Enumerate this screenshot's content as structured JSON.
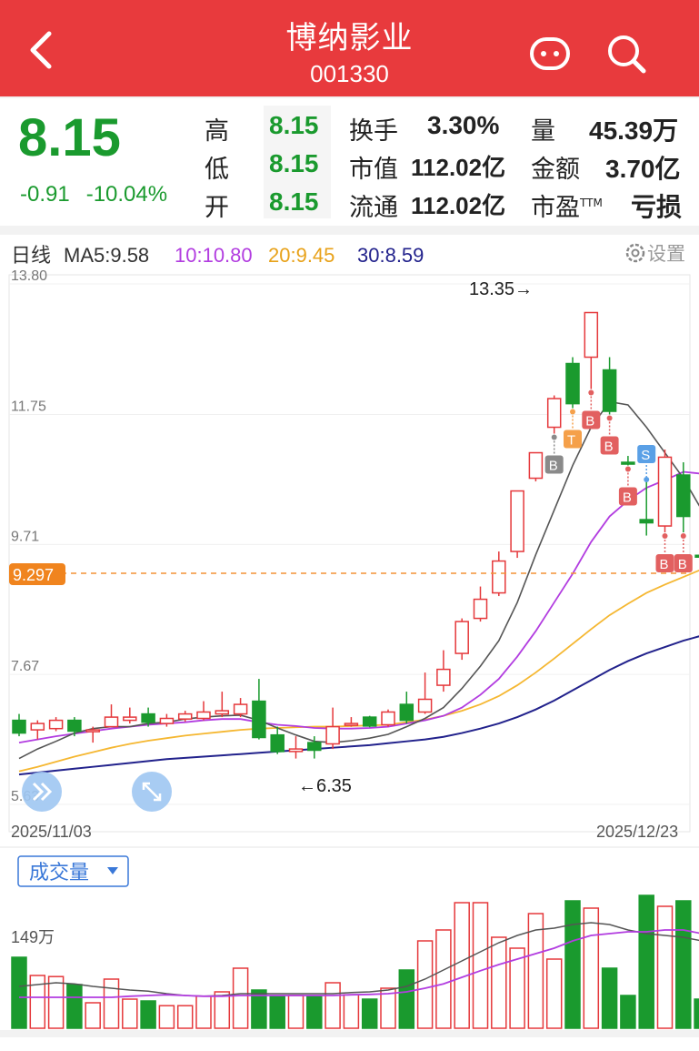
{
  "header": {
    "title": "博纳影业",
    "code": "001330",
    "back_icon": "back-arrow-icon",
    "robot_icon": "robot-face-icon",
    "search_icon": "search-icon"
  },
  "quote": {
    "price": "8.15",
    "change": "-0.91",
    "change_pct": "-10.04%",
    "high_label": "高",
    "high": "8.15",
    "low_label": "低",
    "low": "8.15",
    "open_label": "开",
    "open": "8.15",
    "turnover_label": "换手",
    "turnover": "3.30%",
    "mktcap_label": "市值",
    "mktcap": "112.02亿",
    "float_label": "流通",
    "float_cap": "112.02亿",
    "volume_label": "量",
    "volume": "45.39万",
    "amount_label": "金额",
    "amount": "3.70亿",
    "pe_label": "市盈",
    "pe_sup": "TTM",
    "pe": "亏损",
    "down_color": "#1a9a2e",
    "up_color": "#e5383b"
  },
  "kline": {
    "period": "日线",
    "ma5_label": "MA5:9.58",
    "ma10_label": "10:10.80",
    "ma20_label": "20:9.45",
    "ma30_label": "30:8.59",
    "settings_label": "设置",
    "y_ticks": [
      "13.80",
      "11.75",
      "9.71",
      "7.67",
      "5.63"
    ],
    "price_tag": "9.297",
    "max_label": "13.35→",
    "min_label": "←6.35",
    "start_date": "2025/11/03",
    "end_date": "2025/12/23",
    "ma_colors": {
      "ma5": "#555555",
      "ma10": "#b23de0",
      "ma20": "#f5b731",
      "ma30": "#22228c"
    }
  },
  "volume": {
    "tab_label": "成交量",
    "tick": "149万"
  },
  "chart_data": {
    "type": "candlestick",
    "x_start": "2025/11/03",
    "x_end": "2025/12/23",
    "ylim": [
      5.63,
      13.8
    ],
    "candles": [
      {
        "o": 6.95,
        "c": 6.75,
        "h": 7.05,
        "l": 6.7
      },
      {
        "o": 6.8,
        "c": 6.9,
        "h": 6.95,
        "l": 6.65
      },
      {
        "o": 6.82,
        "c": 6.95,
        "h": 7.0,
        "l": 6.78
      },
      {
        "o": 6.95,
        "c": 6.78,
        "h": 7.0,
        "l": 6.7
      },
      {
        "o": 6.78,
        "c": 6.8,
        "h": 6.85,
        "l": 6.6
      },
      {
        "o": 6.85,
        "c": 7.0,
        "h": 7.2,
        "l": 6.85
      },
      {
        "o": 6.95,
        "c": 7.0,
        "h": 7.15,
        "l": 6.9
      },
      {
        "o": 7.05,
        "c": 6.92,
        "h": 7.15,
        "l": 6.85
      },
      {
        "o": 6.9,
        "c": 6.98,
        "h": 7.05,
        "l": 6.85
      },
      {
        "o": 6.97,
        "c": 7.05,
        "h": 7.1,
        "l": 6.93
      },
      {
        "o": 6.98,
        "c": 7.08,
        "h": 7.25,
        "l": 6.95
      },
      {
        "o": 7.05,
        "c": 7.1,
        "h": 7.4,
        "l": 7.0
      },
      {
        "o": 7.05,
        "c": 7.2,
        "h": 7.3,
        "l": 7.0
      },
      {
        "o": 7.25,
        "c": 6.68,
        "h": 7.6,
        "l": 6.65
      },
      {
        "o": 6.72,
        "c": 6.46,
        "h": 6.85,
        "l": 6.42
      },
      {
        "o": 6.46,
        "c": 6.5,
        "h": 6.7,
        "l": 6.35
      },
      {
        "o": 6.6,
        "c": 6.48,
        "h": 6.7,
        "l": 6.35
      },
      {
        "o": 6.58,
        "c": 6.85,
        "h": 7.15,
        "l": 6.5
      },
      {
        "o": 6.88,
        "c": 6.9,
        "h": 7.0,
        "l": 6.85
      },
      {
        "o": 7.0,
        "c": 6.86,
        "h": 7.02,
        "l": 6.84
      },
      {
        "o": 6.88,
        "c": 7.08,
        "h": 7.12,
        "l": 6.85
      },
      {
        "o": 7.2,
        "c": 6.95,
        "h": 7.4,
        "l": 6.9
      },
      {
        "o": 7.08,
        "c": 7.28,
        "h": 7.7,
        "l": 7.05
      },
      {
        "o": 7.5,
        "c": 7.75,
        "h": 8.05,
        "l": 7.4
      },
      {
        "o": 8.0,
        "c": 8.5,
        "h": 8.55,
        "l": 7.9
      },
      {
        "o": 8.55,
        "c": 8.85,
        "h": 9.05,
        "l": 8.5
      },
      {
        "o": 8.95,
        "c": 9.45,
        "h": 9.6,
        "l": 8.9
      },
      {
        "o": 9.6,
        "c": 10.55,
        "h": 10.55,
        "l": 9.5
      },
      {
        "o": 10.75,
        "c": 11.15,
        "h": 11.15,
        "l": 10.7
      },
      {
        "o": 11.55,
        "c": 12.0,
        "h": 12.05,
        "l": 11.45
      },
      {
        "o": 12.55,
        "c": 11.92,
        "h": 12.65,
        "l": 11.85
      },
      {
        "o": 12.65,
        "c": 13.35,
        "h": 13.35,
        "l": 12.15
      },
      {
        "o": 12.45,
        "c": 11.8,
        "h": 12.65,
        "l": 11.75
      },
      {
        "o": 11.0,
        "c": 10.98,
        "h": 11.1,
        "l": 10.95
      },
      {
        "o": 10.1,
        "c": 10.05,
        "h": 10.7,
        "l": 9.85
      },
      {
        "o": 10.0,
        "c": 11.08,
        "h": 11.2,
        "l": 9.9
      },
      {
        "o": 10.8,
        "c": 10.15,
        "h": 11.0,
        "l": 9.9
      },
      {
        "o": 9.54,
        "c": 9.52,
        "h": 9.6,
        "l": 9.5
      },
      {
        "o": 8.15,
        "c": 8.13,
        "h": 8.18,
        "l": 8.1
      }
    ],
    "ma5": [
      6.35,
      6.5,
      6.62,
      6.75,
      6.82,
      6.85,
      6.85,
      6.9,
      6.92,
      6.97,
      7.0,
      7.02,
      7.03,
      6.95,
      6.83,
      6.72,
      6.62,
      6.6,
      6.63,
      6.67,
      6.73,
      6.85,
      6.98,
      7.15,
      7.45,
      7.8,
      8.2,
      8.8,
      9.55,
      10.25,
      10.95,
      11.55,
      11.95,
      11.9,
      11.55,
      11.15,
      10.75,
      10.25,
      9.55
    ],
    "ma10": [
      6.6,
      6.65,
      6.7,
      6.74,
      6.78,
      6.82,
      6.85,
      6.88,
      6.9,
      6.92,
      6.95,
      6.97,
      6.97,
      6.92,
      6.88,
      6.86,
      6.83,
      6.82,
      6.82,
      6.83,
      6.85,
      6.9,
      6.95,
      7.02,
      7.15,
      7.35,
      7.6,
      7.95,
      8.35,
      8.8,
      9.25,
      9.75,
      10.15,
      10.4,
      10.6,
      10.72,
      10.85,
      10.82,
      10.6
    ],
    "ma20": [
      6.15,
      6.22,
      6.3,
      6.38,
      6.45,
      6.52,
      6.58,
      6.63,
      6.67,
      6.71,
      6.74,
      6.77,
      6.8,
      6.82,
      6.83,
      6.84,
      6.85,
      6.85,
      6.86,
      6.87,
      6.88,
      6.92,
      6.96,
      7.02,
      7.1,
      7.2,
      7.33,
      7.5,
      7.7,
      7.92,
      8.15,
      8.38,
      8.6,
      8.78,
      8.95,
      9.08,
      9.2,
      9.32,
      9.38
    ],
    "ma30": [
      6.1,
      6.13,
      6.16,
      6.19,
      6.22,
      6.25,
      6.28,
      6.31,
      6.34,
      6.36,
      6.38,
      6.4,
      6.42,
      6.44,
      6.46,
      6.48,
      6.5,
      6.52,
      6.54,
      6.56,
      6.59,
      6.62,
      6.65,
      6.69,
      6.75,
      6.82,
      6.9,
      7.0,
      7.12,
      7.26,
      7.42,
      7.58,
      7.74,
      7.88,
      8.0,
      8.1,
      8.2,
      8.28,
      8.32
    ],
    "markers": [
      {
        "i": 29,
        "label": "B",
        "color": "#8a8a8a"
      },
      {
        "i": 30,
        "label": "T",
        "color": "#f5a04a"
      },
      {
        "i": 31,
        "label": "B",
        "color": "#e26060"
      },
      {
        "i": 32,
        "label": "B",
        "color": "#e26060"
      },
      {
        "i": 33,
        "label": "B",
        "color": "#e26060"
      },
      {
        "i": 34,
        "label": "S",
        "color": "#5aa0e6"
      },
      {
        "i": 35,
        "label": "B",
        "color": "#e26060"
      },
      {
        "i": 36,
        "label": "B",
        "color": "#e26060"
      }
    ],
    "volume": [
      1.95,
      1.45,
      1.42,
      1.2,
      0.7,
      1.35,
      0.8,
      0.75,
      0.62,
      0.62,
      0.88,
      1.0,
      1.65,
      1.05,
      0.88,
      0.9,
      0.88,
      1.25,
      0.92,
      0.8,
      1.1,
      1.6,
      2.4,
      2.7,
      3.45,
      3.45,
      2.5,
      2.2,
      3.15,
      1.9,
      3.5,
      3.3,
      1.65,
      0.9,
      3.65,
      3.35,
      3.5,
      0.8,
      0.7
    ],
    "vol_ma": [
      1.15,
      1.2,
      1.25,
      1.22,
      1.15,
      1.1,
      1.05,
      1.02,
      0.95,
      0.9,
      0.88,
      0.9,
      0.95,
      0.95,
      0.95,
      0.95,
      0.95,
      0.95,
      0.98,
      1.0,
      1.05,
      1.15,
      1.35,
      1.6,
      1.85,
      2.1,
      2.35,
      2.55,
      2.7,
      2.75,
      2.85,
      2.9,
      2.85,
      2.7,
      2.6,
      2.55,
      2.5,
      2.4,
      2.3
    ],
    "vol_ma2": [
      0.85,
      0.85,
      0.85,
      0.85,
      0.85,
      0.85,
      0.88,
      0.9,
      0.92,
      0.9,
      0.88,
      0.88,
      0.9,
      0.9,
      0.9,
      0.9,
      0.9,
      0.9,
      0.92,
      0.93,
      0.95,
      1.0,
      1.1,
      1.22,
      1.4,
      1.58,
      1.75,
      1.9,
      2.05,
      2.2,
      2.4,
      2.55,
      2.6,
      2.65,
      2.65,
      2.7,
      2.7,
      2.6,
      2.45
    ]
  }
}
